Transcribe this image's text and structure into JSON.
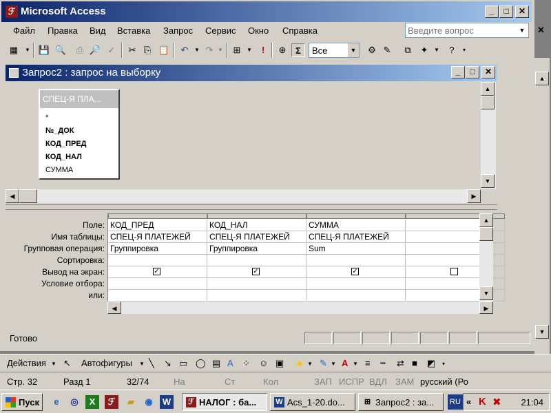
{
  "app": {
    "title": "Microsoft Access"
  },
  "menu": {
    "items": [
      "Файл",
      "Правка",
      "Вид",
      "Вставка",
      "Запрос",
      "Сервис",
      "Окно",
      "Справка"
    ],
    "question_placeholder": "Введите вопрос"
  },
  "toolbar": {
    "totals_value": "Все",
    "sigma_label": "Σ"
  },
  "query_window": {
    "title": "Запрос2 : запрос на выборку",
    "table": {
      "title": "СПЕЦ-Я ПЛА...",
      "fields": [
        {
          "name": "*",
          "key": false
        },
        {
          "name": "№_ДОК",
          "key": true
        },
        {
          "name": "КОД_ПРЕД",
          "key": true
        },
        {
          "name": "КОД_НАЛ",
          "key": true
        },
        {
          "name": "СУММА",
          "key": false
        }
      ]
    },
    "row_labels": [
      "Поле:",
      "Имя таблицы:",
      "Групповая операция:",
      "Сортировка:",
      "Вывод на экран:",
      "Условие отбора:",
      "или:"
    ],
    "columns": [
      {
        "field": "КОД_ПРЕД",
        "table": "СПЕЦ-Я ПЛАТЕЖЕЙ",
        "total": "Группировка",
        "sort": "",
        "show": true
      },
      {
        "field": "КОД_НАЛ",
        "table": "СПЕЦ-Я ПЛАТЕЖЕЙ",
        "total": "Группировка",
        "sort": "",
        "show": true
      },
      {
        "field": "СУММА",
        "table": "СПЕЦ-Я ПЛАТЕЖЕЙ",
        "total": "Sum",
        "sort": "",
        "show": true
      },
      {
        "field": "",
        "table": "",
        "total": "",
        "sort": "",
        "show": false
      }
    ]
  },
  "status": {
    "text": "Готово"
  },
  "draw_toolbar": {
    "actions_label": "Действия",
    "autoshapes_label": "Автофигуры"
  },
  "word_status": {
    "page": "Стр. 32",
    "section": "Разд 1",
    "pages": "32/74",
    "at": "На",
    "line": "Ст",
    "col": "Кол",
    "rec": "ЗАП",
    "trk": "ИСПР",
    "ext": "ВДЛ",
    "ovr": "ЗАМ",
    "language": "русский (Ро"
  },
  "taskbar": {
    "start_label": "Пуск",
    "tasks": [
      "НАЛОГ : ба...",
      "Acs_1-20.do...",
      "Запрос2 : за..."
    ],
    "lang_indicator": "RU",
    "clock": "21:04"
  }
}
